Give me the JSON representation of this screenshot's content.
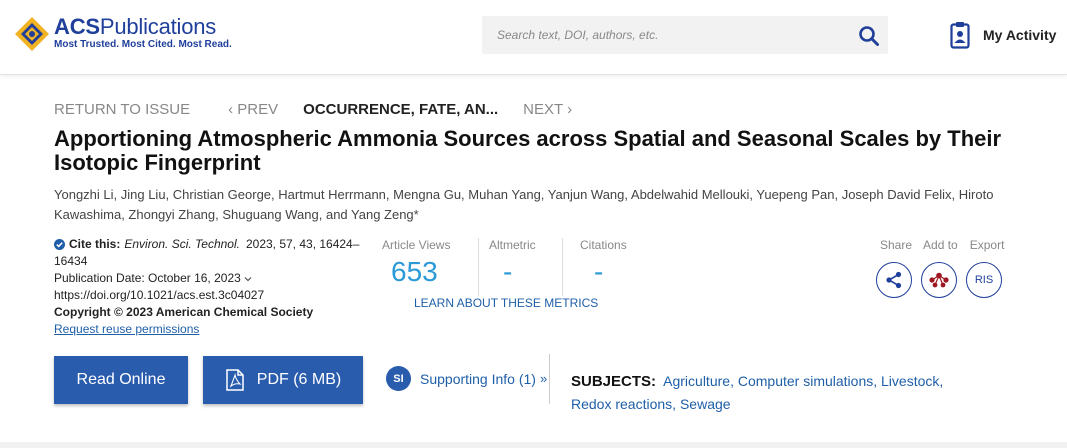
{
  "header": {
    "logo": {
      "brand_bold": "ACS",
      "brand_regular": "Publications",
      "tagline": "Most Trusted. Most Cited. Most Read."
    },
    "search": {
      "placeholder": "Search text, DOI, authors, etc.",
      "value": ""
    },
    "activity_label": "My Activity"
  },
  "nav": {
    "return": "RETURN TO ISSUE",
    "prev": "‹ PREV",
    "current": "OCCURRENCE, FATE, AN...",
    "next": "NEXT ›"
  },
  "article": {
    "title": "Apportioning Atmospheric Ammonia Sources across Spatial and Seasonal Scales by Their Isotopic Fingerprint",
    "authors": "Yongzhi Li, Jing Liu, Christian George, Hartmut Herrmann, Mengna Gu, Muhan Yang, Yanjun Wang, Abdelwahid Mellouki, Yuepeng Pan, Joseph David Felix, Hiroto Kawashima, Zhongyi Zhang, Shuguang Wang, and Yang Zeng*"
  },
  "citation": {
    "label": "Cite this:",
    "journal": "Environ. Sci. Technol.",
    "details": "2023, 57, 43, 16424–",
    "pages_cont": "16434",
    "pub_date": "Publication Date: October 16, 2023",
    "doi": "https://doi.org/10.1021/acs.est.3c04027",
    "copyright": "Copyright © 2023 American Chemical Society",
    "reuse": "Request reuse permissions"
  },
  "metrics": {
    "views_label": "Article Views",
    "views_value": "653",
    "altmetric_label": "Altmetric",
    "altmetric_value": "-",
    "citations_label": "Citations",
    "citations_value": "-",
    "learn_more": "LEARN ABOUT THESE METRICS"
  },
  "actions": {
    "share": "Share",
    "add_to": "Add to",
    "export": "Export",
    "ris": "RIS"
  },
  "buttons": {
    "read_online": "Read Online",
    "pdf": "PDF (6 MB)"
  },
  "supporting": {
    "badge": "SI",
    "label": "Supporting Info (1)",
    "chevron": "»"
  },
  "subjects": {
    "label": "SUBJECTS:",
    "items": [
      "Agriculture",
      "Computer simulations",
      "Livestock",
      "Redox reactions",
      "Sewage"
    ]
  },
  "colors": {
    "brand_blue": "#1f3f9b",
    "button_blue": "#2a5cae",
    "metric_blue": "#2b9ad6",
    "logo_gold": "#f0b323",
    "mendeley_red": "#9d1620"
  }
}
